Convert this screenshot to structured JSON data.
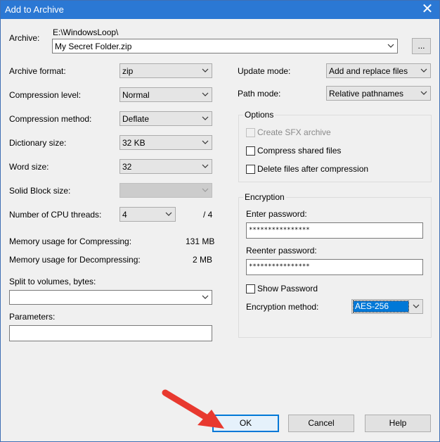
{
  "window": {
    "title": "Add to Archive"
  },
  "archive": {
    "label": "Archive:",
    "path": "E:\\WindowsLoop\\",
    "filename": "My Secret Folder.zip",
    "browse_label": "..."
  },
  "left": {
    "archive_format": {
      "label": "Archive format:",
      "value": "zip"
    },
    "compression_level": {
      "label": "Compression level:",
      "value": "Normal"
    },
    "compression_method": {
      "label": "Compression method:",
      "value": "Deflate"
    },
    "dictionary_size": {
      "label": "Dictionary size:",
      "value": "32 KB"
    },
    "word_size": {
      "label": "Word size:",
      "value": "32"
    },
    "solid_block": {
      "label": "Solid Block size:",
      "value": ""
    },
    "cpu_threads": {
      "label": "Number of CPU threads:",
      "value": "4",
      "total": "/ 4"
    },
    "mem_compress": {
      "label": "Memory usage for Compressing:",
      "value": "131 MB"
    },
    "mem_decompress": {
      "label": "Memory usage for Decompressing:",
      "value": "2 MB"
    },
    "split": {
      "label": "Split to volumes, bytes:",
      "value": ""
    },
    "parameters": {
      "label": "Parameters:",
      "value": ""
    }
  },
  "right": {
    "update_mode": {
      "label": "Update mode:",
      "value": "Add and replace files"
    },
    "path_mode": {
      "label": "Path mode:",
      "value": "Relative pathnames"
    },
    "options": {
      "legend": "Options",
      "create_sfx": "Create SFX archive",
      "compress_shared": "Compress shared files",
      "delete_after": "Delete files after compression"
    },
    "encryption": {
      "legend": "Encryption",
      "enter_password_label": "Enter password:",
      "enter_password_value": "****************",
      "reenter_password_label": "Reenter password:",
      "reenter_password_value": "****************",
      "show_password": "Show Password",
      "method_label": "Encryption method:",
      "method_value": "AES-256"
    }
  },
  "buttons": {
    "ok": "OK",
    "cancel": "Cancel",
    "help": "Help"
  },
  "colors": {
    "titlebar": "#2b78d4",
    "arrow": "#e8392f",
    "focus": "#0078d7"
  },
  "icons": {
    "close": "close-icon",
    "dropdown": "chevron-down-icon",
    "annotation": "red-arrow-annotation"
  }
}
